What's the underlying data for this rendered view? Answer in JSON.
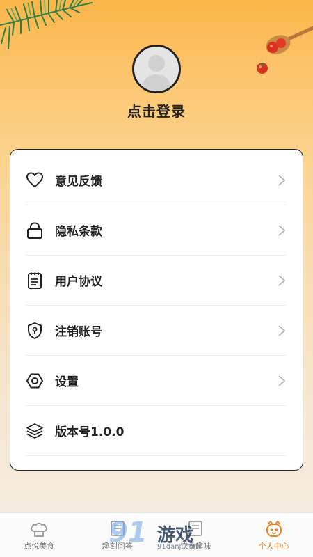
{
  "profile": {
    "login_text": "点击登录"
  },
  "menu": {
    "items": [
      {
        "label": "意见反馈",
        "icon": "heart-icon",
        "has_arrow": true
      },
      {
        "label": "隐私条款",
        "icon": "lock-icon",
        "has_arrow": true
      },
      {
        "label": "用户协议",
        "icon": "document-icon",
        "has_arrow": true
      },
      {
        "label": "注销账号",
        "icon": "shield-keyhole-icon",
        "has_arrow": true
      },
      {
        "label": "设置",
        "icon": "hexagon-gear-icon",
        "has_arrow": true
      },
      {
        "label": "版本号1.0.0",
        "icon": "layers-icon",
        "has_arrow": false
      }
    ]
  },
  "tabbar": {
    "tabs": [
      {
        "label": "点悦美食",
        "icon": "chef-hat-icon",
        "active": false
      },
      {
        "label": "趣刻问答",
        "icon": "quiz-icon",
        "active": false
      },
      {
        "label": "饮食趣味",
        "icon": "food-fun-icon",
        "active": false
      },
      {
        "label": "个人中心",
        "icon": "face-icon",
        "active": true
      }
    ]
  },
  "watermark": {
    "number": "91",
    "text": "游戏",
    "url": "91danji.com"
  },
  "colors": {
    "accent": "#f07f1e",
    "header_top": "#fbb548"
  }
}
